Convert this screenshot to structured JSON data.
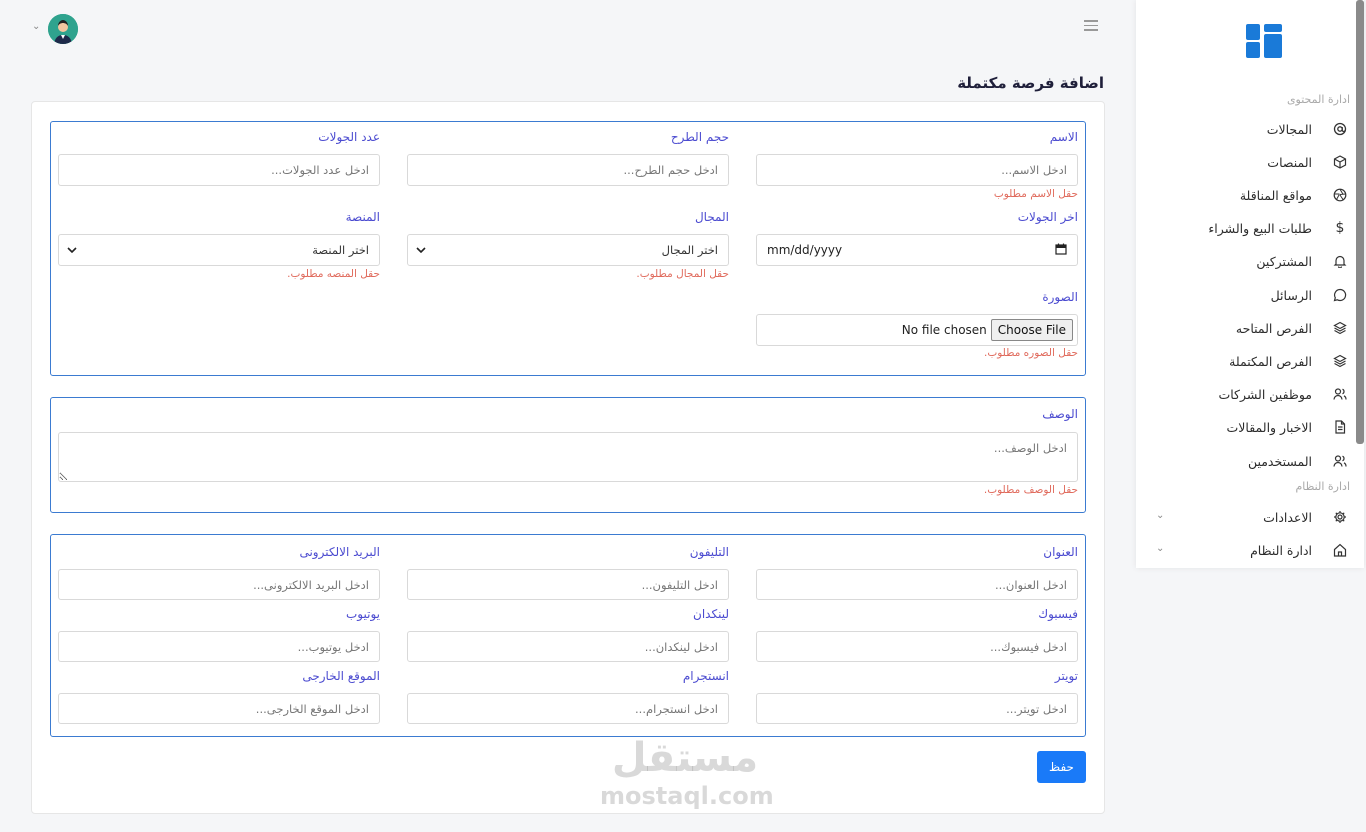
{
  "sidebar": {
    "content_section": "ادارة المحتوى",
    "system_section": "ادارة النظام",
    "items": [
      {
        "label": "المجالات",
        "icon": "at-icon"
      },
      {
        "label": "المنصات",
        "icon": "box-icon"
      },
      {
        "label": "مواقع المناقلة",
        "icon": "aperture-icon"
      },
      {
        "label": "طلبات البيع والشراء",
        "icon": "dollar-icon"
      },
      {
        "label": "المشتركين",
        "icon": "bell-icon"
      },
      {
        "label": "الرسائل",
        "icon": "message-icon"
      },
      {
        "label": "الفرص المتاحه",
        "icon": "layers-icon"
      },
      {
        "label": "الفرص المكتملة",
        "icon": "layers-icon"
      },
      {
        "label": "موظفين الشركات",
        "icon": "users-icon"
      },
      {
        "label": "الاخبار والمقالات",
        "icon": "file-icon"
      },
      {
        "label": "المستخدمين",
        "icon": "users-icon"
      }
    ],
    "system_items": [
      {
        "label": "الاعدادات",
        "icon": "gear-icon"
      },
      {
        "label": "ادارة النظام",
        "icon": "home-icon"
      }
    ]
  },
  "page": {
    "title": "اضافة فرصة مكتملة"
  },
  "form": {
    "name": {
      "label": "الاسم",
      "placeholder": "ادخل الاسم...",
      "error": "حقل الاسم مطلوب"
    },
    "pitch_size": {
      "label": "حجم الطرح",
      "placeholder": "ادخل حجم الطرح..."
    },
    "rounds_count": {
      "label": "عدد الجولات",
      "placeholder": "ادخل عدد الجولات..."
    },
    "last_round": {
      "label": "اخر الجولات",
      "value": "mm/dd/yyyy"
    },
    "field": {
      "label": "المجال",
      "value": "اختر المجال",
      "error": "حقل المجال مطلوب."
    },
    "platform": {
      "label": "المنصة",
      "value": "اختر المنصة",
      "error": "حقل المنصه مطلوب."
    },
    "image": {
      "label": "الصورة",
      "button": "Choose File",
      "status": "No file chosen",
      "error": "حقل الصوره مطلوب."
    },
    "description": {
      "label": "الوصف",
      "placeholder": "ادخل الوصف...",
      "error": "حقل الوصف مطلوب."
    },
    "address": {
      "label": "العنوان",
      "placeholder": "ادخل العنوان..."
    },
    "phone": {
      "label": "التليفون",
      "placeholder": "ادخل التليفون..."
    },
    "email": {
      "label": "البريد الالكترونى",
      "placeholder": "ادخل البريد الالكترونى..."
    },
    "facebook": {
      "label": "فيسبوك",
      "placeholder": "ادخل فيسبوك..."
    },
    "linkedin": {
      "label": "لينكدان",
      "placeholder": "ادخل لينكدان..."
    },
    "youtube": {
      "label": "يوتيوب",
      "placeholder": "ادخل يوتيوب..."
    },
    "twitter": {
      "label": "تويتر",
      "placeholder": "ادخل تويتر..."
    },
    "instagram": {
      "label": "انستجرام",
      "placeholder": "ادخل انستجرام..."
    },
    "website": {
      "label": "الموقع الخارجى",
      "placeholder": "ادخل الموقع الخارجى..."
    },
    "save": "حفظ"
  },
  "watermark": {
    "arabic": "مستقل",
    "latin": "mostaql.com"
  },
  "colors": {
    "accent": "#1a7af8",
    "label": "#4b4bd0",
    "error": "#e06a5c",
    "border": "#3b7bd1"
  }
}
